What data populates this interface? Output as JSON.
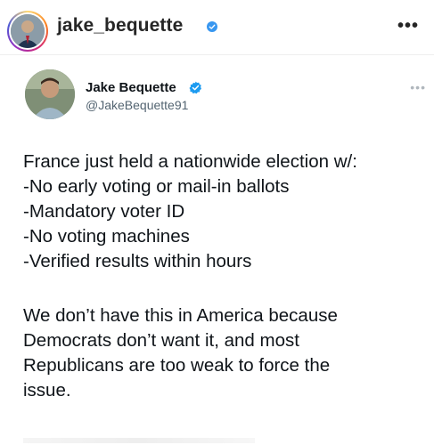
{
  "instagram": {
    "username": "jake_bequette",
    "verified_icon": "verified-badge-icon",
    "more_label": "•••",
    "colors": {
      "verified": "#3897f0"
    }
  },
  "tweet": {
    "name": "Jake Bequette",
    "handle": "@JakeBequette91",
    "more_label": "•••",
    "lines": [
      "France just held a nationwide election w/:",
      "-No early voting or mail-in ballots",
      "-Mandatory voter ID",
      "-No voting machines",
      "-Verified results within hours"
    ],
    "paragraph2": [
      "We don’t have this in America because",
      "Democrats don’t want it, and most",
      "Republicans are too weak to force the",
      "issue."
    ],
    "colors": {
      "verified": "#1d9bf0",
      "text": "#0f1419",
      "handle": "#536471"
    }
  }
}
